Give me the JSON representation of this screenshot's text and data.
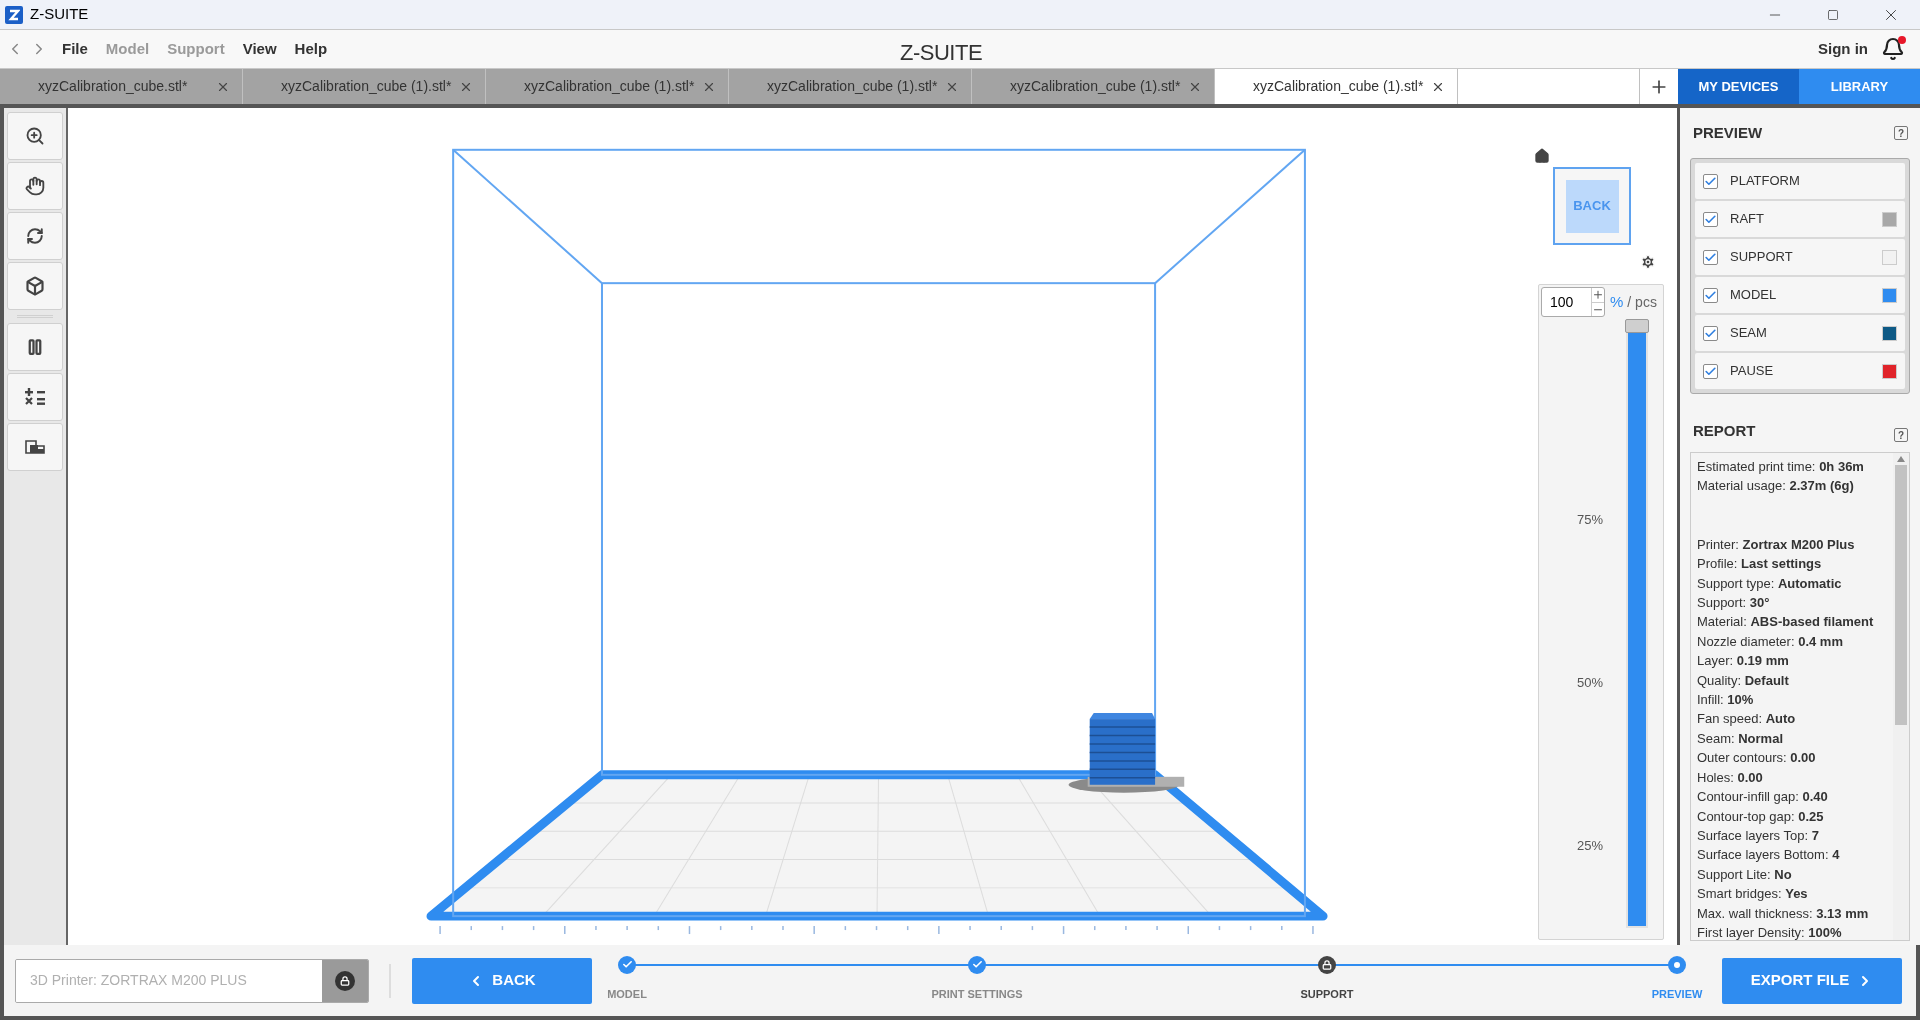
{
  "window": {
    "title": "Z-SUITE"
  },
  "menu": [
    {
      "label": "File",
      "disabled": false
    },
    {
      "label": "Model",
      "disabled": true
    },
    {
      "label": "Support",
      "disabled": true
    },
    {
      "label": "View",
      "disabled": false
    },
    {
      "label": "Help",
      "disabled": false
    }
  ],
  "logo": "Z-SUITE",
  "account": {
    "sign_in": "Sign in",
    "has_notification": true
  },
  "tabs": [
    {
      "label": "xyzCalibration_cube.stl*",
      "selected": false
    },
    {
      "label": "xyzCalibration_cube (1).stl*",
      "selected": false
    },
    {
      "label": "xyzCalibration_cube (1).stl*",
      "selected": false
    },
    {
      "label": "xyzCalibration_cube (1).stl*",
      "selected": false
    },
    {
      "label": "xyzCalibration_cube (1).stl*",
      "selected": false
    },
    {
      "label": "xyzCalibration_cube (1).stl*",
      "selected": true
    }
  ],
  "side_tabs": [
    {
      "label": "MY DEVICES",
      "selected": true
    },
    {
      "label": "LIBRARY",
      "selected": false
    }
  ],
  "viewport": {
    "view_cube": "BACK",
    "layer_input": {
      "value": "100",
      "unit": "%",
      "alt_unit": "/ pcs"
    },
    "slider": {
      "level": 1,
      "marks": [
        "75%",
        "50%",
        "25%"
      ]
    }
  },
  "preview": {
    "title": "PREVIEW",
    "help": "?",
    "items": [
      {
        "label": "PLATFORM",
        "checked": true
      },
      {
        "label": "RAFT",
        "checked": true,
        "color": "#a8a8a8"
      },
      {
        "label": "SUPPORT",
        "checked": true,
        "color": "#f2f2f2"
      },
      {
        "label": "MODEL",
        "checked": true,
        "color": "#2f8cf0"
      },
      {
        "label": "SEAM",
        "checked": true,
        "color": "#0e5a86"
      },
      {
        "label": "PAUSE",
        "checked": true,
        "color": "#e0242a"
      }
    ]
  },
  "report": {
    "title": "REPORT",
    "help": "?",
    "summary": [
      {
        "label": "Estimated print time:",
        "value": "0h 36m"
      },
      {
        "label": "Material usage:",
        "value": "2.37m (6g)"
      }
    ],
    "settings": [
      {
        "label": "Printer:",
        "value": "Zortrax M200 Plus"
      },
      {
        "label": "Profile:",
        "value": "Last settings"
      },
      {
        "label": "Support type:",
        "value": "Automatic"
      },
      {
        "label": "Support:",
        "value": "30°"
      },
      {
        "label": "Material:",
        "value": "ABS-based filament"
      },
      {
        "label": "Nozzle diameter:",
        "value": "0.4 mm"
      },
      {
        "label": "Layer:",
        "value": "0.19 mm"
      },
      {
        "label": "Quality:",
        "value": "Default"
      },
      {
        "label": "Infill:",
        "value": "10%"
      },
      {
        "label": "Fan speed:",
        "value": "Auto"
      },
      {
        "label": "Seam:",
        "value": "Normal"
      },
      {
        "label": "Outer contours:",
        "value": "0.00"
      },
      {
        "label": "Holes:",
        "value": "0.00"
      },
      {
        "label": "Contour-infill gap:",
        "value": "0.40"
      },
      {
        "label": "Contour-top gap:",
        "value": "0.25"
      },
      {
        "label": "Surface layers Top:",
        "value": "7"
      },
      {
        "label": "Surface layers Bottom:",
        "value": "4"
      },
      {
        "label": "Support Lite:",
        "value": "No"
      },
      {
        "label": "Smart bridges:",
        "value": "Yes"
      },
      {
        "label": "Max. wall thickness:",
        "value": "3.13 mm"
      },
      {
        "label": "First layer Density:",
        "value": "100%"
      }
    ]
  },
  "bottom": {
    "printer_field": {
      "placeholder": "3D Printer: ZORTRAX M200 PLUS"
    },
    "back_button": "BACK",
    "steps": [
      {
        "label": "MODEL",
        "kind": "done"
      },
      {
        "label": "PRINT SETTINGS",
        "kind": "done"
      },
      {
        "label": "SUPPORT",
        "kind": "locked"
      },
      {
        "label": "PREVIEW",
        "kind": "current"
      }
    ],
    "export_button": "EXPORT FILE"
  }
}
